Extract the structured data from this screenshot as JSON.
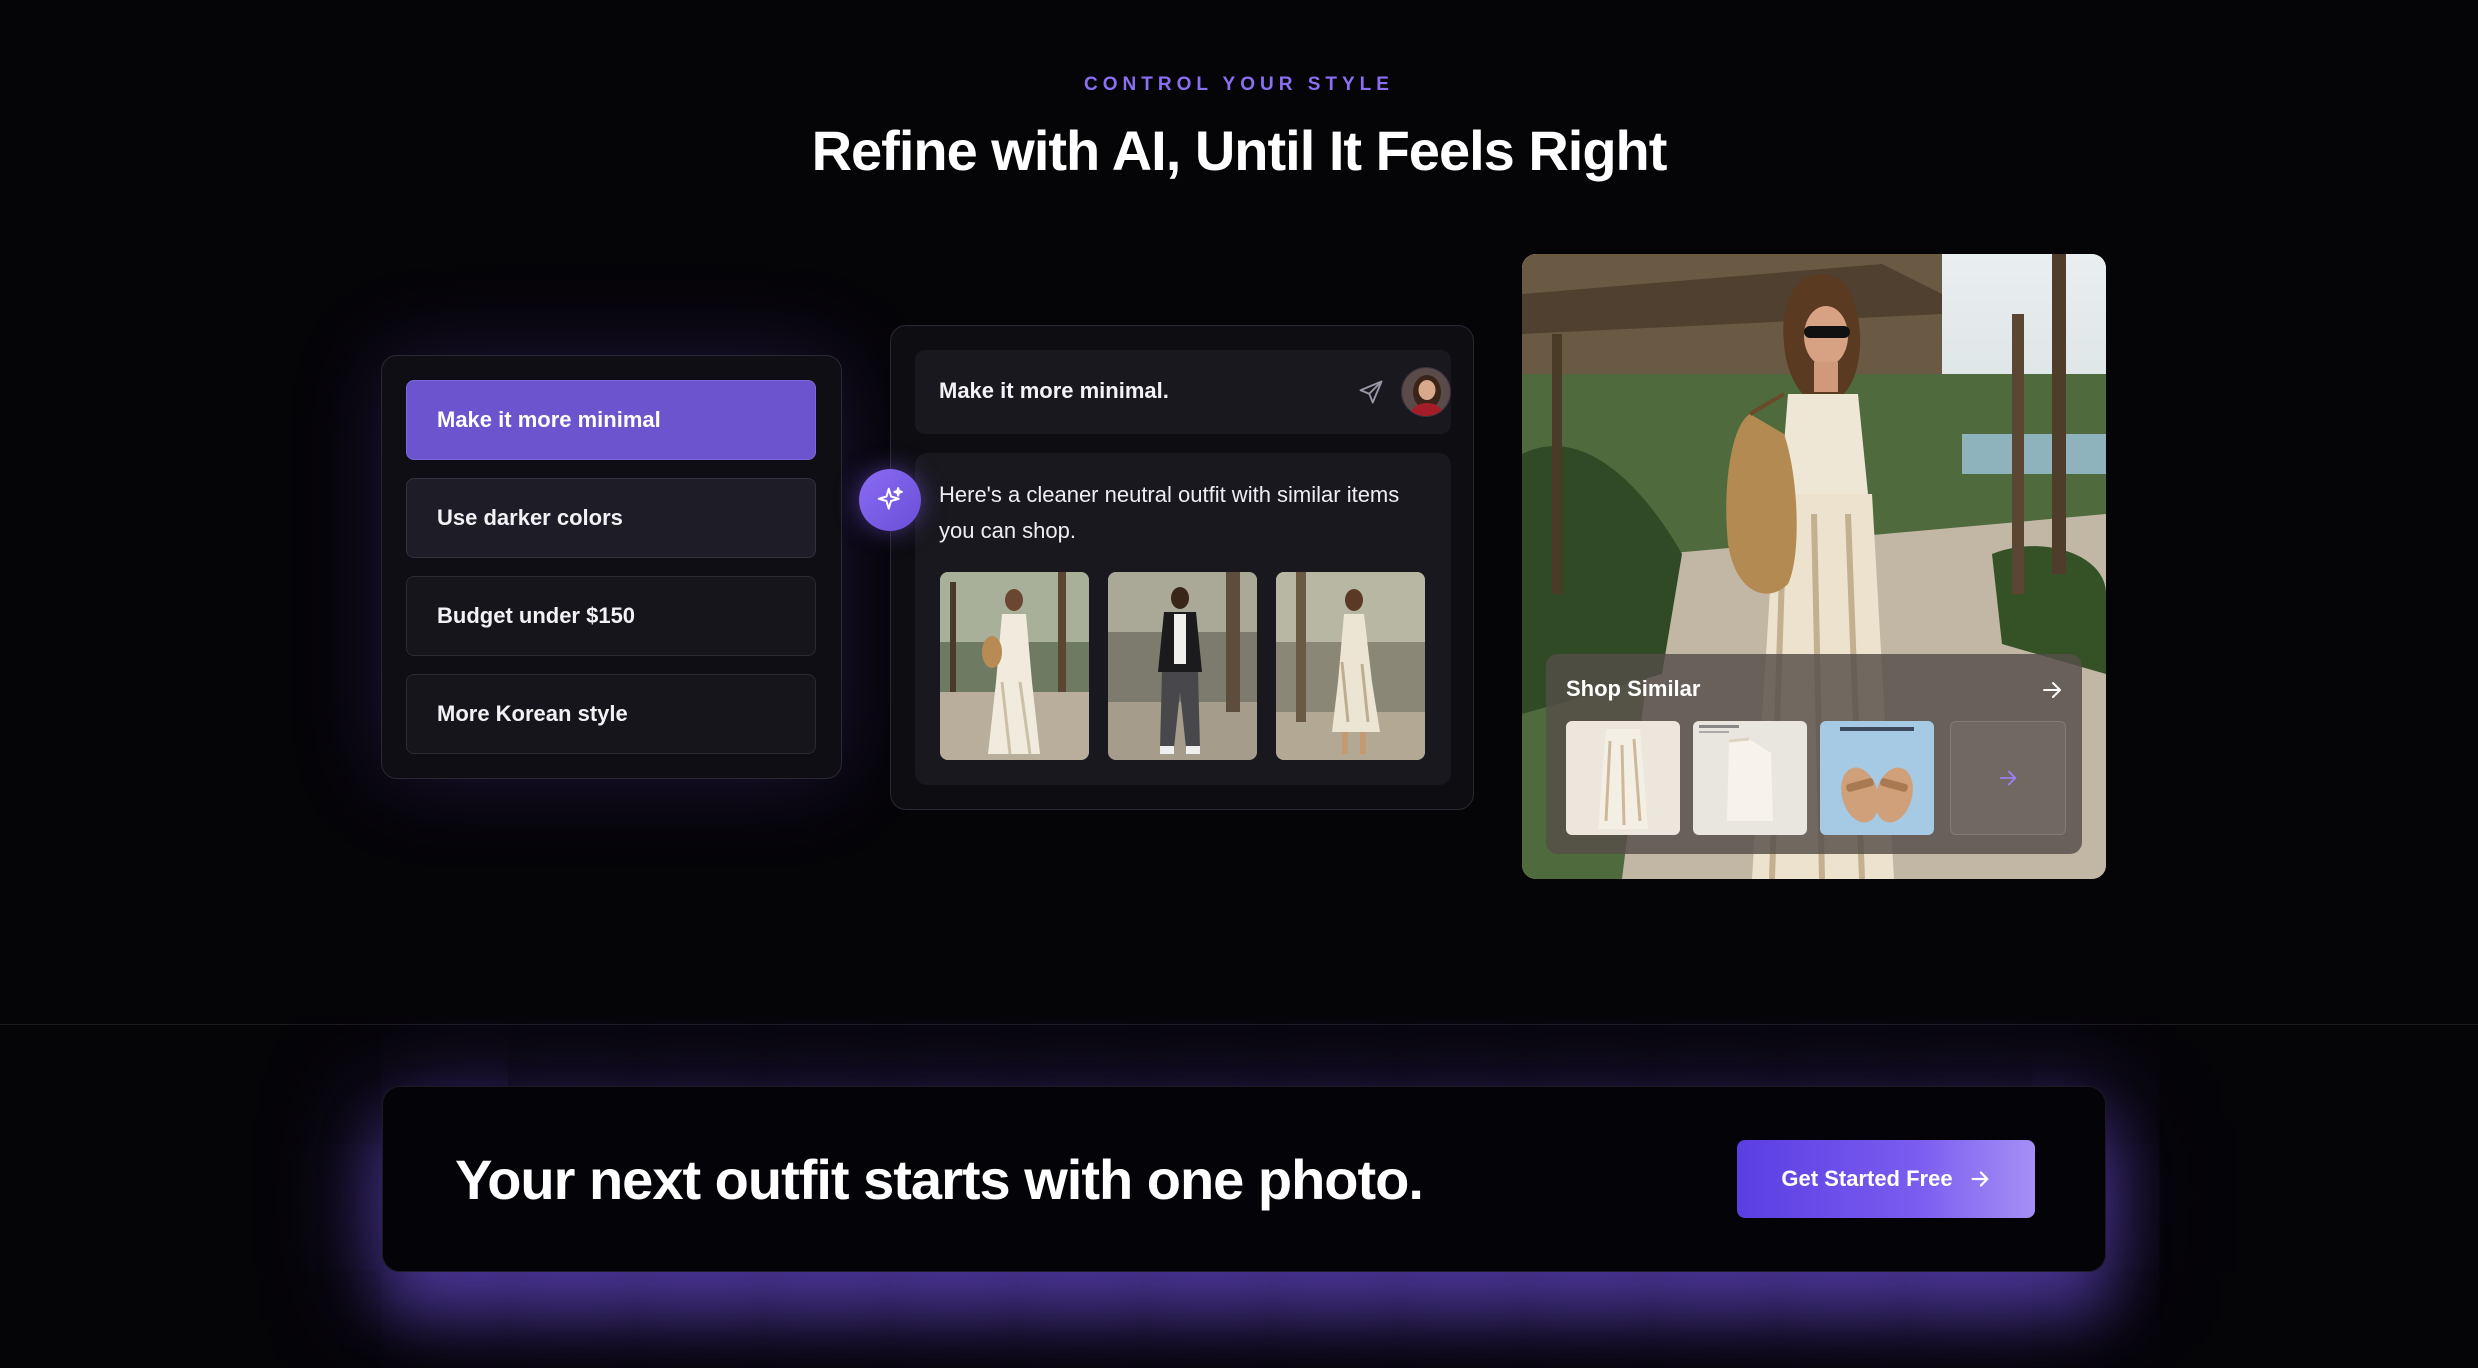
{
  "section": {
    "eyebrow": "CONTROL YOUR STYLE",
    "title": "Refine with AI, Until It Feels Right"
  },
  "suggestions": [
    {
      "label": "Make it more minimal",
      "state": "selected"
    },
    {
      "label": "Use darker colors",
      "state": "default"
    },
    {
      "label": "Budget under $150",
      "state": "default"
    },
    {
      "label": "More Korean style",
      "state": "default"
    }
  ],
  "chat": {
    "user_message": "Make it more minimal.",
    "reply": "Here's a cleaner neutral outfit with similar items you can shop.",
    "icons": {
      "send": "send-icon",
      "ai": "sparkles-icon",
      "user": "avatar"
    }
  },
  "shop": {
    "title": "Shop Similar",
    "icons": {
      "header": "arrow-right-icon",
      "more": "arrow-right-icon"
    }
  },
  "cta": {
    "headline": "Your next outfit starts with one photo.",
    "button_label": "Get Started Free"
  },
  "colors": {
    "background": "#050407",
    "accent": "#8b6ff3",
    "selected_chip": "#6c54cf",
    "cta_gradient_start": "#5b3ee2",
    "cta_gradient_end": "#a58ff5"
  }
}
